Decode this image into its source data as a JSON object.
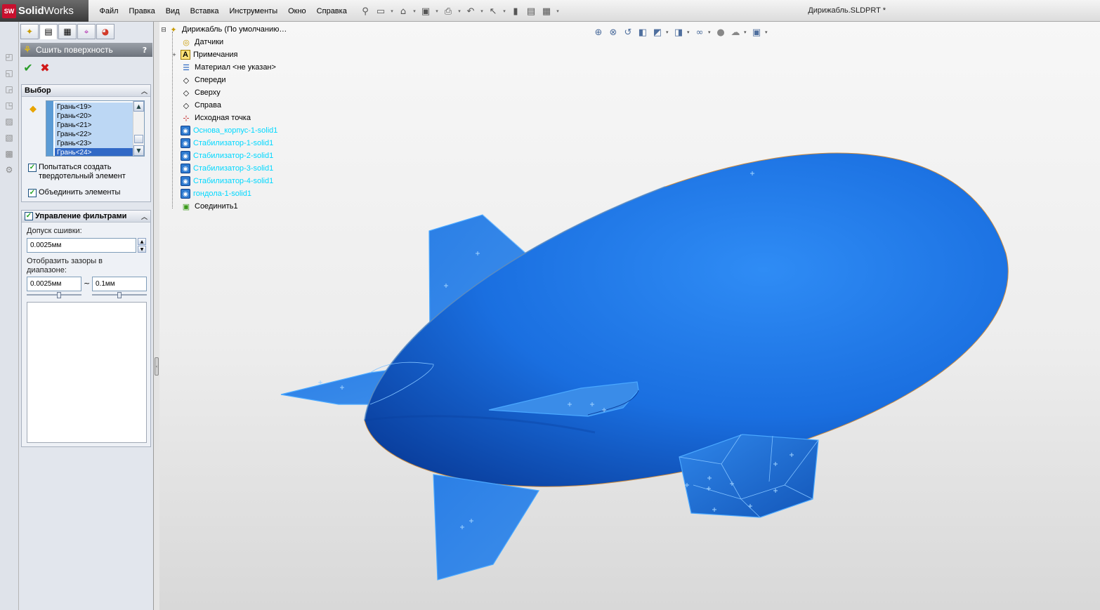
{
  "app": {
    "logo_badge": "SW",
    "logo_solid": "Solid",
    "logo_works": "Works",
    "document_title": "Дирижабль.SLDPRT *"
  },
  "menu": [
    "Файл",
    "Правка",
    "Вид",
    "Вставка",
    "Инструменты",
    "Окно",
    "Справка"
  ],
  "property_manager": {
    "title": "Сшить поверхность",
    "help": "?",
    "ok_icon": "check-icon",
    "cancel_icon": "x-icon",
    "selection_group": {
      "title": "Выбор",
      "faces": [
        "Грань<19>",
        "Грань<20>",
        "Грань<21>",
        "Грань<22>",
        "Грань<23>",
        "Грань<24>"
      ],
      "selected_face": "Грань<24>",
      "try_solid_label": "Попытаться создать твердотельный элемент",
      "try_solid_checked": true,
      "merge_label": "Объединить элементы",
      "merge_checked": true
    },
    "filter_group": {
      "title": "Управление фильтрами",
      "enabled": true,
      "tolerance_label": "Допуск сшивки:",
      "tolerance_value": "0.0025мм",
      "gap_range_label": "Отобразить зазоры в диапазоне:",
      "gap_min": "0.0025мм",
      "gap_max": "0.1мм",
      "range_separator": "~"
    }
  },
  "feature_tree": {
    "root": "Дирижабль  (По умолчанию…",
    "items": [
      {
        "label": "Датчики",
        "icon": "sensor-icon",
        "type": "folder",
        "expandable": false
      },
      {
        "label": "Примечания",
        "icon": "annotation-icon",
        "type": "folder",
        "expandable": true
      },
      {
        "label": "Материал <не указан>",
        "icon": "material-icon",
        "type": "folder",
        "expandable": false
      },
      {
        "label": "Спереди",
        "icon": "plane-icon",
        "type": "plane",
        "expandable": false
      },
      {
        "label": "Сверху",
        "icon": "plane-icon",
        "type": "plane",
        "expandable": false
      },
      {
        "label": "Справа",
        "icon": "plane-icon",
        "type": "plane",
        "expandable": false
      },
      {
        "label": "Исходная точка",
        "icon": "origin-icon",
        "type": "origin",
        "expandable": false
      },
      {
        "label": "Основа_корпус-1-solid1",
        "icon": "imported-body-icon",
        "type": "body",
        "expandable": false
      },
      {
        "label": "Стабилизатор-1-solid1",
        "icon": "imported-body-icon",
        "type": "body",
        "expandable": false
      },
      {
        "label": "Стабилизатор-2-solid1",
        "icon": "imported-body-icon",
        "type": "body",
        "expandable": false
      },
      {
        "label": "Стабилизатор-3-solid1",
        "icon": "imported-body-icon",
        "type": "body",
        "expandable": false
      },
      {
        "label": "Стабилизатор-4-solid1",
        "icon": "imported-body-icon",
        "type": "body",
        "expandable": false
      },
      {
        "label": "гондола-1-solid1",
        "icon": "imported-body-icon",
        "type": "body",
        "expandable": false
      },
      {
        "label": "Соединить1",
        "icon": "knit-icon",
        "type": "feature",
        "expandable": false
      }
    ]
  },
  "colors": {
    "airship_body": "#1a6fe0",
    "airship_dark": "#0a3f9e",
    "airship_highlight": "#2f8cf5",
    "fin_fill": "#3c8dea",
    "edge": "#4aa8ff",
    "imported_label": "#00d8ff"
  }
}
